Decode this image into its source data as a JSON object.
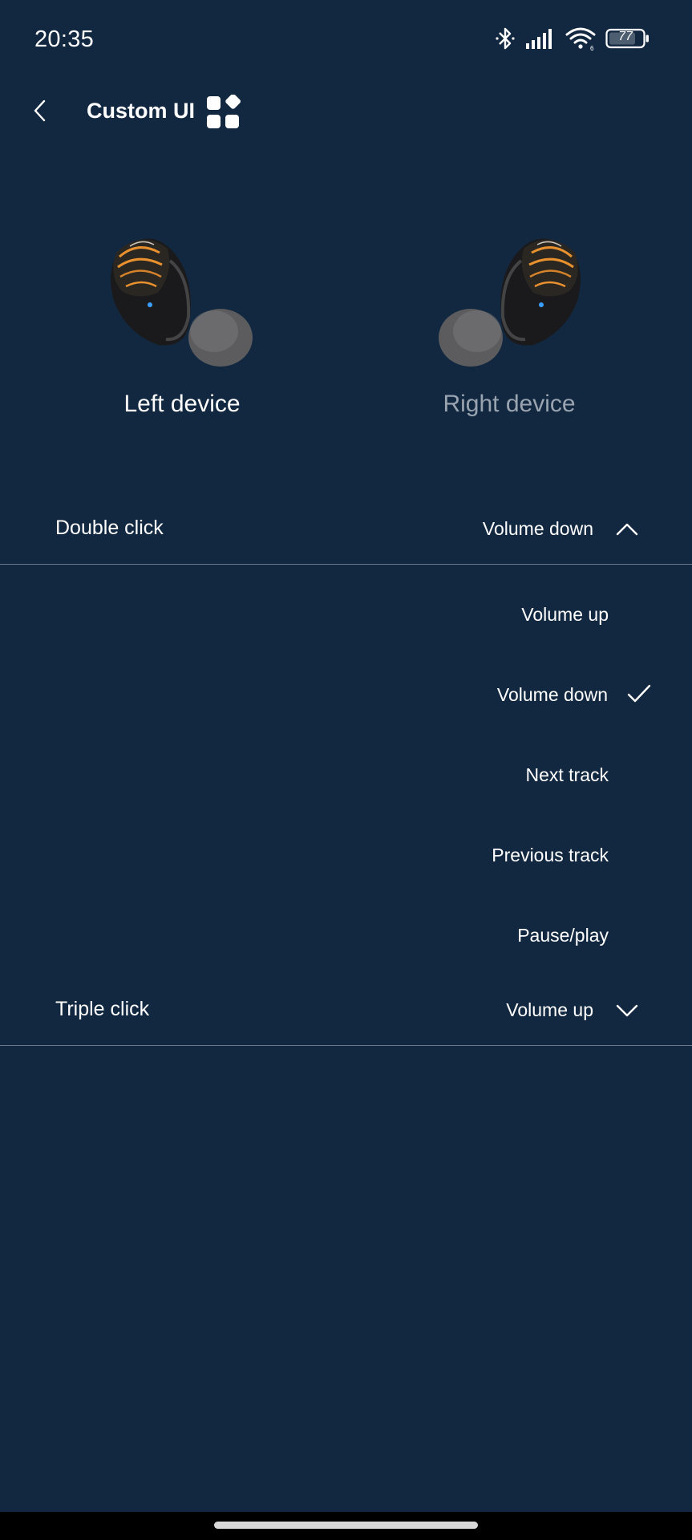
{
  "status_bar": {
    "time": "20:35",
    "battery": "77",
    "icons": [
      "bluetooth-icon",
      "signal-icon",
      "wifi-icon",
      "battery-icon"
    ]
  },
  "header": {
    "title": "Custom UI"
  },
  "devices": {
    "left": {
      "label": "Left device",
      "selected": true
    },
    "right": {
      "label": "Right device",
      "selected": false
    }
  },
  "double_click": {
    "label": "Double click",
    "value": "Volume down",
    "expanded": true,
    "options": [
      {
        "label": "Volume up",
        "selected": false
      },
      {
        "label": "Volume down",
        "selected": true
      },
      {
        "label": "Next track",
        "selected": false
      },
      {
        "label": "Previous track",
        "selected": false
      },
      {
        "label": "Pause/play",
        "selected": false
      }
    ]
  },
  "triple_click": {
    "label": "Triple click",
    "value": "Volume up",
    "expanded": false
  },
  "colors": {
    "background": "#122840",
    "divider": "#6b7a8a",
    "inactive_text": "#9aa4b0",
    "accent_orange": "#e8912e"
  }
}
